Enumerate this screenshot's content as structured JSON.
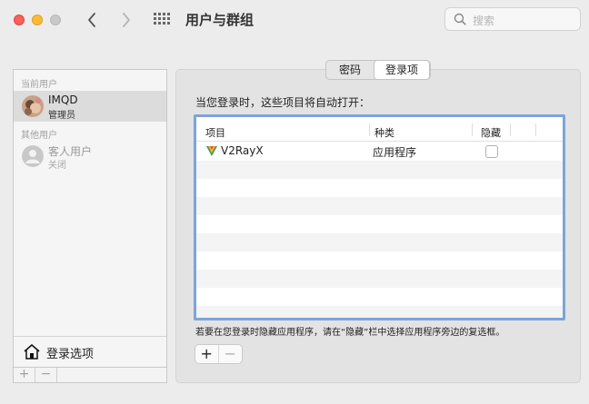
{
  "window": {
    "title": "用户与群组"
  },
  "search": {
    "placeholder": "搜索"
  },
  "sidebar": {
    "current_section": "当前用户",
    "other_section": "其他用户",
    "current_user": {
      "name": "IMQD",
      "role": "管理员"
    },
    "guest_user": {
      "name": "客人用户",
      "status": "关闭"
    },
    "login_options_label": "登录选项",
    "add_label": "+",
    "remove_label": "−"
  },
  "tabs": {
    "password": "密码",
    "login_items": "登录项"
  },
  "main": {
    "intro": "当您登录时，这些项目将自动打开：",
    "columns": {
      "item": "项目",
      "kind": "种类",
      "hide": "隐藏"
    },
    "rows": [
      {
        "name": "V2RayX",
        "kind": "应用程序",
        "hidden": false
      }
    ],
    "hint": "若要在您登录时隐藏应用程序，请在“隐藏”栏中选择应用程序旁边的复选框。",
    "add_label": "+",
    "remove_label": "−"
  },
  "colors": {
    "selection_border": "#7ba4dc",
    "close": "#fe5f57",
    "minimize": "#febc2e"
  }
}
